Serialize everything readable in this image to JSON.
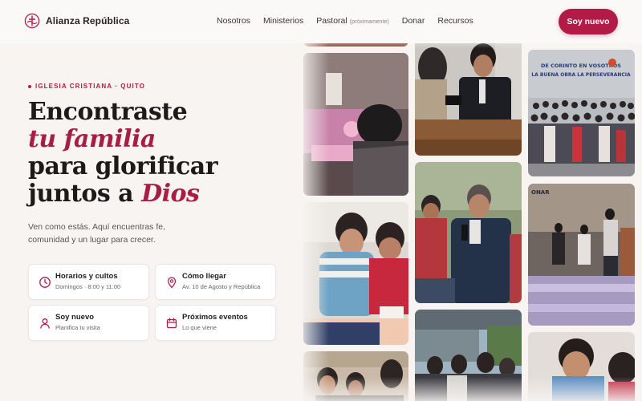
{
  "brand": {
    "name": "Alianza República",
    "accent": "#b21b45"
  },
  "nav": {
    "items": [
      {
        "label": "Nosotros"
      },
      {
        "label": "Ministerios"
      },
      {
        "label": "Pastoral",
        "note": "(próximamente)"
      },
      {
        "label": "Donar"
      },
      {
        "label": "Recursos"
      }
    ],
    "cta": "Soy nuevo"
  },
  "hero": {
    "eyebrow": "IGLESIA CRISTIANA · QUITO",
    "headline": {
      "line1": "Encontraste",
      "line2": "tu familia",
      "line3": "para glorificar",
      "line4_prefix": "juntos a ",
      "line4_emph": "Dios"
    },
    "lead": "Ven como estás. Aquí encuentras fe, comunidad y un lugar para crecer."
  },
  "cards": [
    {
      "title": "Horarios y cultos",
      "subtitle": "Domingos · 8:00 y 11:00",
      "icon": "clock-icon"
    },
    {
      "title": "Cómo llegar",
      "subtitle": "Av. 10 de Agosto y República",
      "icon": "map-pin-icon"
    },
    {
      "title": "Soy nuevo",
      "subtitle": "Planifica tu visita",
      "icon": "user-icon"
    },
    {
      "title": "Próximos eventos",
      "subtitle": "Lo que viene",
      "icon": "calendar-icon"
    }
  ],
  "photos": {
    "banner_line1": "DE CORINTO EN VOSOTROS",
    "banner_line2": "LA BUENA OBRA LA PERSEVERANCIA",
    "sign_text": "ONAR"
  }
}
